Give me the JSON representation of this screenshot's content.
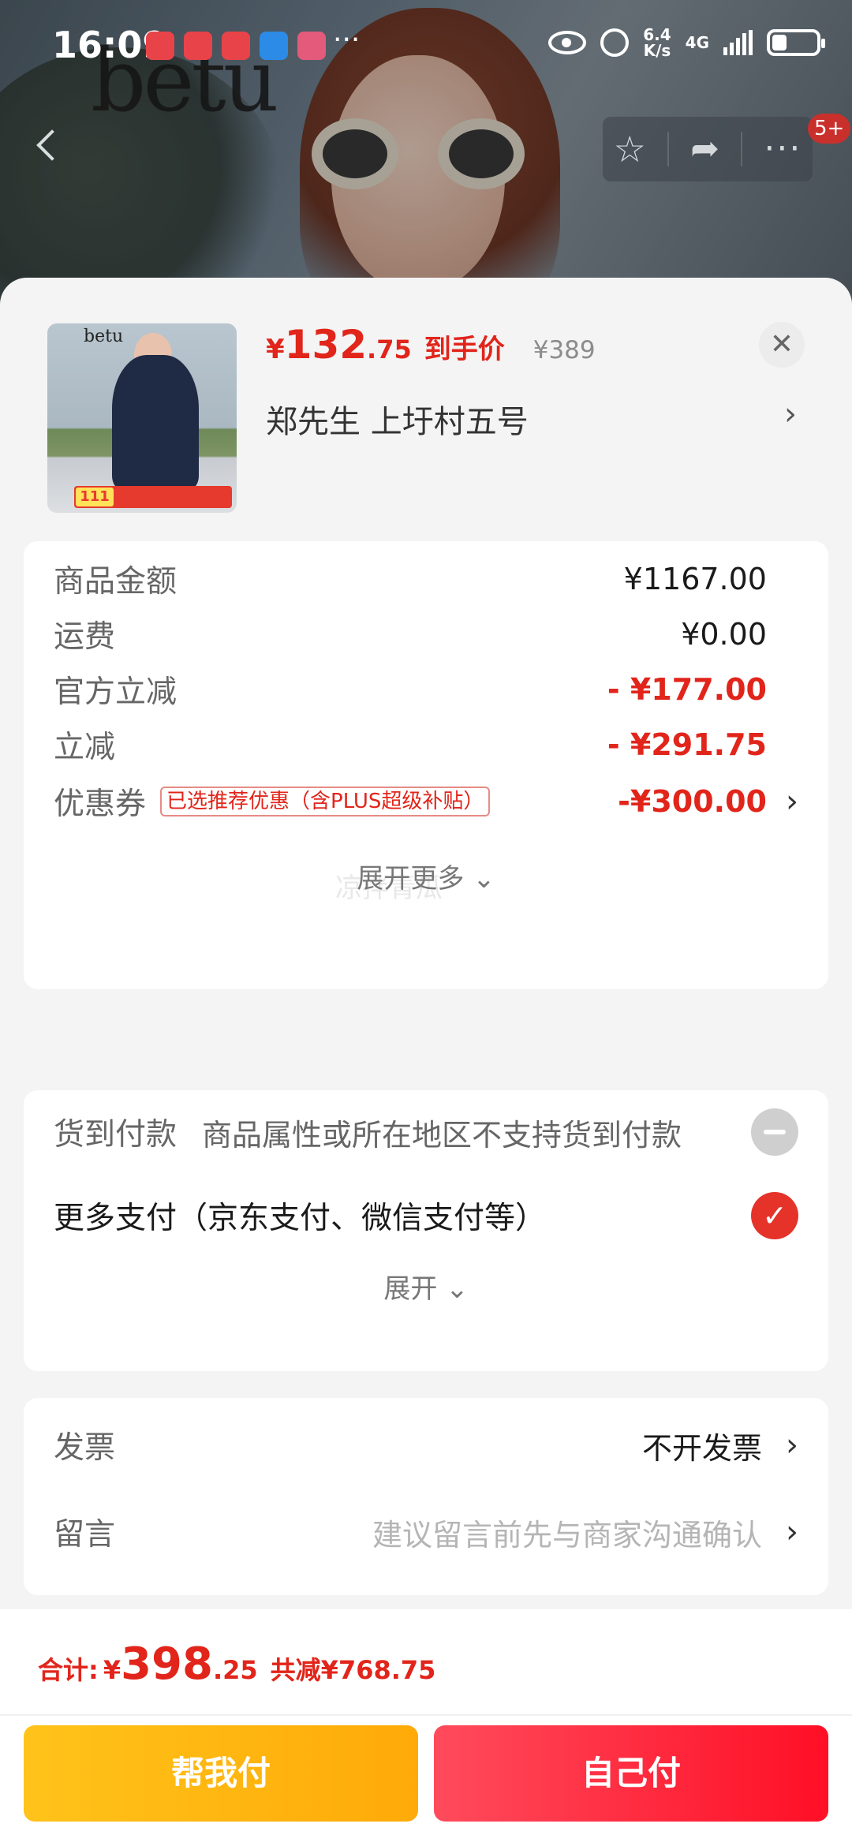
{
  "status_bar": {
    "time": "16:09",
    "more": "···",
    "speed_value": "6.4",
    "speed_unit": "K/s",
    "network": "4G"
  },
  "nav": {
    "badge": "5+",
    "icons": [
      "back-icon",
      "star-icon",
      "share-icon",
      "more-icon"
    ]
  },
  "product": {
    "currency": "¥",
    "price_int": "132",
    "price_dec": ".75",
    "price_label": "到手价",
    "original_price": "¥389",
    "close": "✕",
    "address": "郑先生  上圩村五号",
    "thumb_logo": "betu",
    "thumb_tag_num": "111"
  },
  "summary": {
    "rows": [
      {
        "label": "商品金额",
        "value": "¥1167.00"
      },
      {
        "label": "运费",
        "value": "¥0.00"
      },
      {
        "label": "官方立减",
        "value": "- ¥177.00"
      },
      {
        "label": "立减",
        "value": "- ¥291.75"
      },
      {
        "label": "优惠券",
        "value": "-¥300.00",
        "tag": "已选推荐优惠（含PLUS超级补贴）"
      }
    ],
    "expand_more": "展开更多 ⌄",
    "watermark": "凉拌青瓜"
  },
  "payment": {
    "cod_label": "货到付款",
    "cod_desc": "商品属性或所在地区不支持货到付款",
    "more_label": "更多支付（京东支付、微信支付等）",
    "expand": "展开 ⌄"
  },
  "extras": {
    "invoice_label": "发票",
    "invoice_value": "不开发票",
    "memo_label": "留言",
    "memo_placeholder": "建议留言前先与商家沟通确认"
  },
  "footer": {
    "total_label": "合计:",
    "currency": "¥",
    "total_int": "398",
    "total_dec": ".25",
    "saved": "共减¥768.75",
    "help_pay": "帮我付",
    "self_pay": "自己付"
  },
  "colors": {
    "accent_red": "#e1251b",
    "help_button": "#ffb20f",
    "self_button": "#ff1f35"
  }
}
